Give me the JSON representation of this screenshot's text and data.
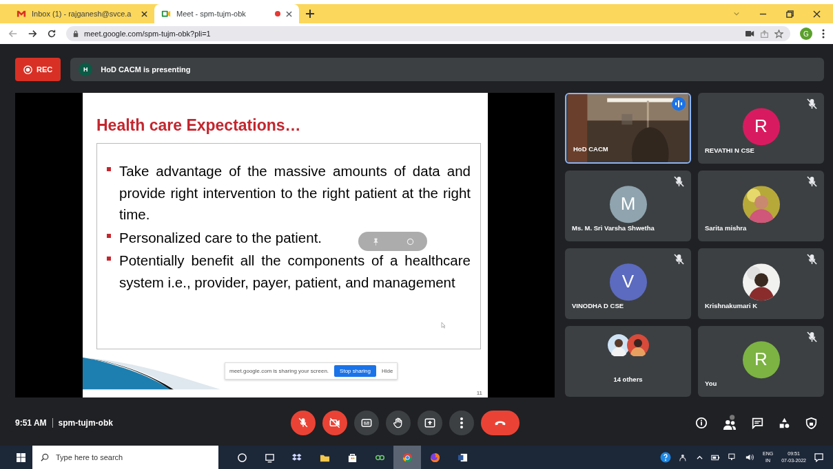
{
  "browser": {
    "tabs": [
      {
        "kind": "mail",
        "title": "Inbox (1) - rajganesh@svce.a",
        "selected": false,
        "recording": false
      },
      {
        "kind": "meet",
        "title": "Meet - spm-tujm-obk",
        "selected": true,
        "recording": true
      }
    ],
    "url": "meet.google.com/spm-tujm-obk?pli=1",
    "profile_letter": "G"
  },
  "meeting": {
    "rec_label": "REC",
    "presenter_letter": "H",
    "presenting": "HoD CACM is presenting",
    "slide": {
      "title": "Health care Expectations…",
      "bullets": [
        "Take advantage of the massive amounts of data and provide right intervention to the right patient at the right time.",
        "Personalized care to the patient.",
        "Potentially benefit all the components of a healthcare system i.e., provider, payer, patient, and management"
      ],
      "page": "11"
    },
    "share_bar": {
      "message": "meet.google.com is sharing your screen.",
      "stop": "Stop sharing",
      "hide": "Hide"
    },
    "tiles": [
      {
        "kind": "video",
        "name": "HoD CACM",
        "speaking": true,
        "muted": false
      },
      {
        "kind": "letter",
        "name": "REVATHI N CSE",
        "letter": "R",
        "color": "#d81b60",
        "speaking": false,
        "muted": true
      },
      {
        "kind": "letter",
        "name": "Ms. M. Sri Varsha Shwetha",
        "letter": "M",
        "color": "#8fa4ae",
        "speaking": false,
        "muted": true
      },
      {
        "name": "Sarita mishra",
        "speaking": false,
        "muted": true
      },
      {
        "kind": "letter",
        "name": "VINODHA D CSE",
        "letter": "V",
        "color": "#5c6bc0",
        "speaking": false,
        "muted": true
      },
      {
        "name": "Krishnakumari K",
        "speaking": false,
        "muted": true
      },
      {
        "kind": "others",
        "name": "14 others"
      },
      {
        "kind": "letter",
        "name": "You",
        "letter": "R",
        "color": "#7cb342",
        "speaking": false,
        "muted": true
      }
    ],
    "time": "9:51 AM",
    "code": "spm-tujm-obk",
    "controls": [
      {
        "kind": "mic",
        "on": false
      },
      {
        "kind": "camera",
        "on": false
      },
      {
        "kind": "captions"
      },
      {
        "kind": "hand"
      },
      {
        "kind": "present"
      },
      {
        "kind": "more"
      },
      {
        "kind": "hangup"
      }
    ]
  },
  "taskbar": {
    "search_placeholder": "Type here to search",
    "lang": "ENG",
    "region": "IN",
    "clock": "09:51",
    "date": "07-03-2022"
  }
}
